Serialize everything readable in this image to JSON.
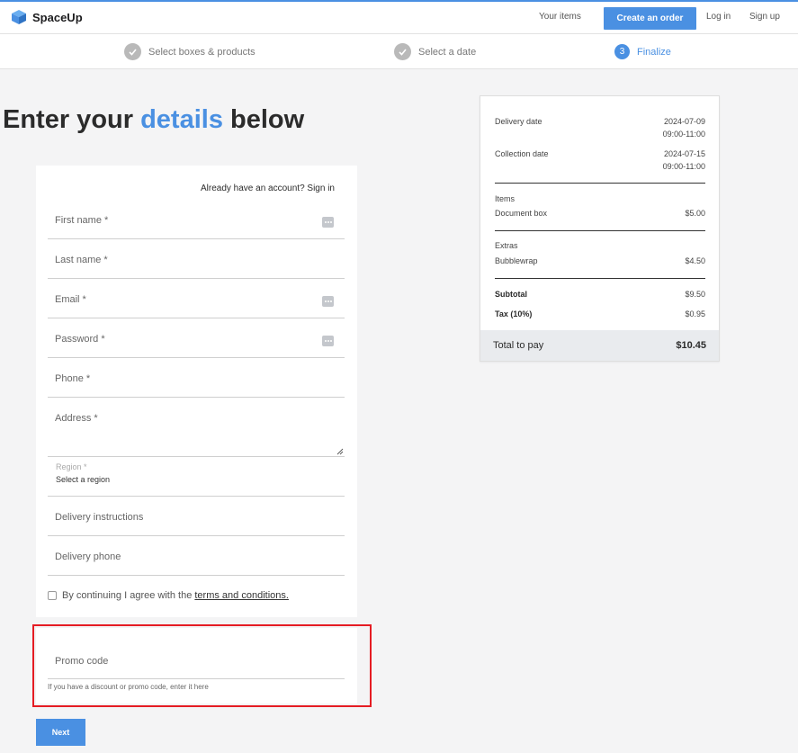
{
  "header": {
    "brand": "SpaceUp",
    "your_items": "Your items",
    "create_order": "Create an order",
    "log_in": "Log in",
    "sign_up": "Sign up"
  },
  "steps": [
    {
      "label": "Select boxes & products",
      "state": "done"
    },
    {
      "label": "Select a date",
      "state": "done"
    },
    {
      "number": "3",
      "label": "Finalize",
      "state": "active"
    }
  ],
  "heading": {
    "pre": "Enter your ",
    "accent": "details",
    "post": " below"
  },
  "form": {
    "signin_prompt": "Already have an account? Sign in",
    "first_name": "First name *",
    "last_name": "Last name *",
    "email": "Email *",
    "password": "Password *",
    "phone": "Phone *",
    "address": "Address *",
    "region_label": "Region *",
    "region_value": "Select a region",
    "delivery_instructions": "Delivery instructions",
    "delivery_phone": "Delivery phone",
    "terms_text": "By continuing I agree with the ",
    "terms_link": "terms and conditions."
  },
  "promo": {
    "label": "Promo code",
    "help": "If you have a discount or promo code, enter it here"
  },
  "next_button": "Next",
  "summary": {
    "delivery_label": "Delivery date",
    "delivery_date": "2024-07-09",
    "delivery_time": "09:00-11:00",
    "collection_label": "Collection date",
    "collection_date": "2024-07-15",
    "collection_time": "09:00-11:00",
    "items_title": "Items",
    "item_name": "Document box",
    "item_price": "$5.00",
    "extras_title": "Extras",
    "extra_name": "Bubblewrap",
    "extra_price": "$4.50",
    "subtotal_label": "Subtotal",
    "subtotal": "$9.50",
    "tax_label": "Tax (10%)",
    "tax": "$0.95",
    "total_label": "Total to pay",
    "total": "$10.45"
  },
  "colors": {
    "accent": "#4a90e2",
    "highlight": "#e51c23"
  }
}
